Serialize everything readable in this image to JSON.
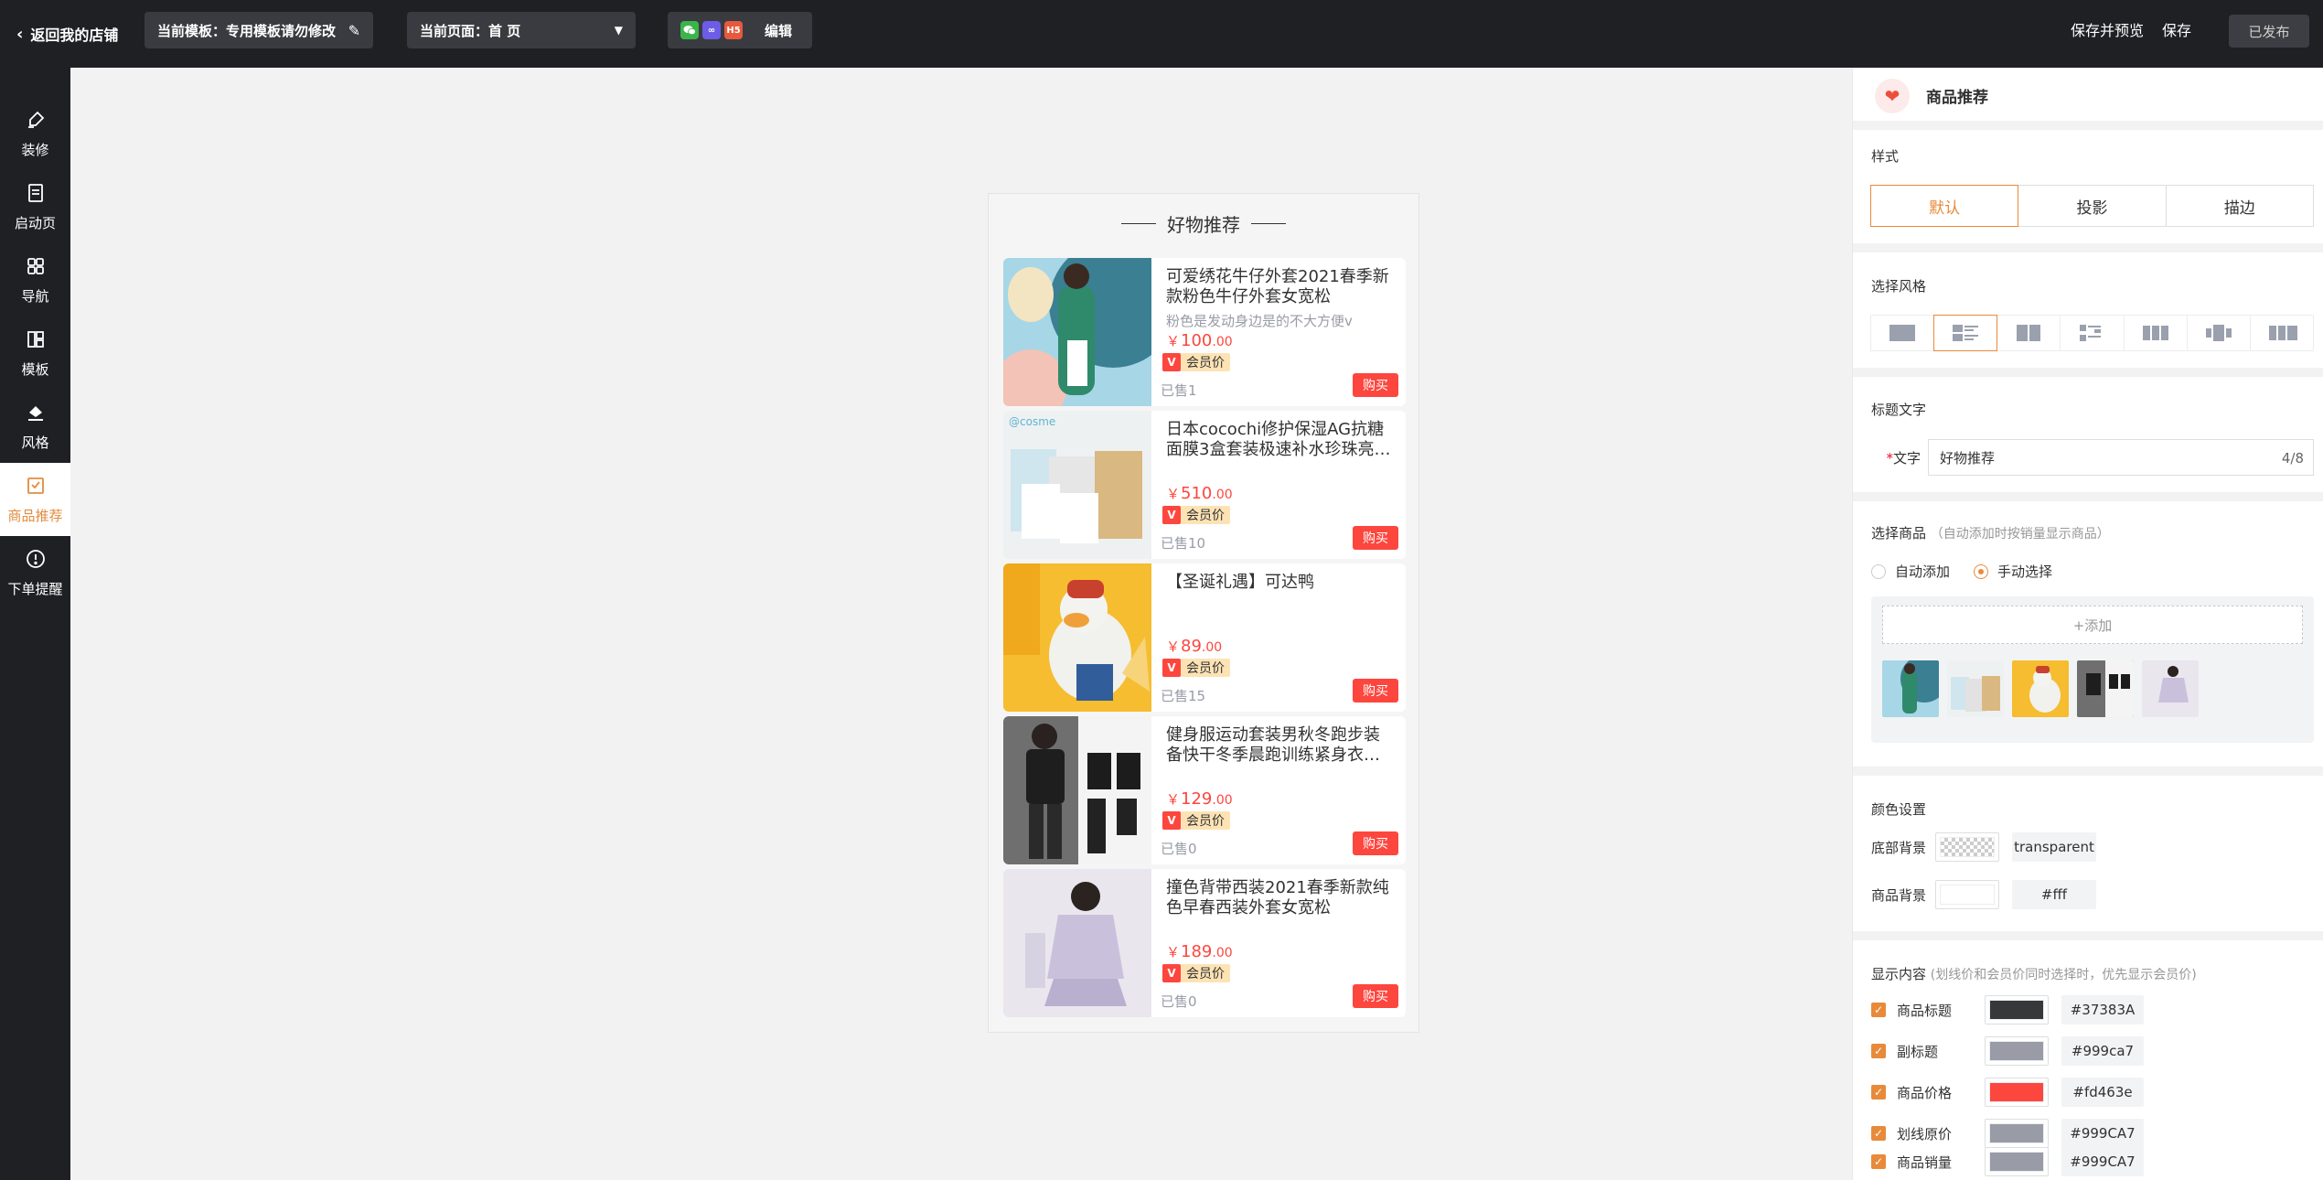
{
  "topbar": {
    "back_label": "返回我的店铺",
    "template_label": "当前模板：专用模板请勿修改",
    "page_label": "当前页面：首 页",
    "channel_icons": [
      "wechat-icon",
      "link-icon",
      "h5-icon"
    ],
    "h5_text": "H5",
    "edit_label": "编辑",
    "save_preview_label": "保存并预览",
    "save_label": "保存",
    "published_label": "已发布"
  },
  "sidebar": {
    "items": [
      {
        "label": "装修",
        "icon": "paintbrush-icon"
      },
      {
        "label": "启动页",
        "icon": "doc-icon"
      },
      {
        "label": "导航",
        "icon": "grid-icon"
      },
      {
        "label": "模板",
        "icon": "layout-icon"
      },
      {
        "label": "风格",
        "icon": "bucket-icon"
      },
      {
        "label": "商品推荐",
        "icon": "recommend-icon",
        "active": true
      },
      {
        "label": "下单提醒",
        "icon": "alert-icon"
      }
    ]
  },
  "preview": {
    "title": "好物推荐",
    "products": [
      {
        "title": "可爱绣花牛仔外套2021春季新款粉色牛仔外套女宽松",
        "subtitle": "粉色是发动身边是的不大方便v",
        "currency": "￥",
        "price_int": "100",
        "price_dec": ".00",
        "vip_label": "会员价",
        "sold": "已售1",
        "buy": "购买"
      },
      {
        "title": "日本cocochi修护保湿AG抗糖面膜3盒套装极速补水珍珠亮白…",
        "subtitle": "",
        "currency": "￥",
        "price_int": "510",
        "price_dec": ".00",
        "vip_label": "会员价",
        "sold": "已售10",
        "buy": "购买"
      },
      {
        "title": "【圣诞礼遇】可达鸭",
        "subtitle": "",
        "currency": "￥",
        "price_int": "89",
        "price_dec": ".00",
        "vip_label": "会员价",
        "sold": "已售15",
        "buy": "购买"
      },
      {
        "title": "健身服运动套装男秋冬跑步装备快干冬季晨跑训练紧身衣冬…",
        "subtitle": "",
        "currency": "￥",
        "price_int": "129",
        "price_dec": ".00",
        "vip_label": "会员价",
        "sold": "已售0",
        "buy": "购买"
      },
      {
        "title": "撞色背带西装2021春季新款纯色早春西装外套女宽松",
        "subtitle": "",
        "currency": "￥",
        "price_int": "189",
        "price_dec": ".00",
        "vip_label": "会员价",
        "sold": "已售0",
        "buy": "购买"
      }
    ],
    "vip_badge": "V"
  },
  "panel": {
    "header_title": "商品推荐",
    "style_label": "样式",
    "style_options": [
      "默认",
      "投影",
      "描边"
    ],
    "layout_label": "选择风格",
    "title_section_label": "标题文字",
    "title_field_label": "文字",
    "required_mark": "*",
    "title_value": "好物推荐",
    "title_count": "4/8",
    "goods_label": "选择商品",
    "goods_hint": "（自动添加时按销量显示商品）",
    "radio_auto": "自动添加",
    "radio_manual": "手动选择",
    "add_label": "+添加",
    "color_section_label": "颜色设置",
    "bg_label": "底部背景",
    "bg_value": "transparent",
    "goods_bg_label": "商品背景",
    "goods_bg_value": "#fff",
    "display_label": "显示内容",
    "display_hint": "(划线价和会员价同时选择时，优先显示会员价)",
    "display_items": [
      {
        "label": "商品标题",
        "hex": "#37383A",
        "color": "#37383A"
      },
      {
        "label": "副标题",
        "hex": "#999ca7",
        "color": "#999ca7"
      },
      {
        "label": "商品价格",
        "hex": "#fd463e",
        "color": "#fd463e"
      },
      {
        "label": "划线原价",
        "hex": "#999CA7",
        "color": "#999CA7"
      },
      {
        "label": "商品销量",
        "hex": "#999CA7",
        "color": "#999CA7"
      }
    ]
  },
  "colors": {
    "accent": "#e88a3a",
    "price_red": "#fd463e",
    "topbar_bg": "#1f2024"
  }
}
